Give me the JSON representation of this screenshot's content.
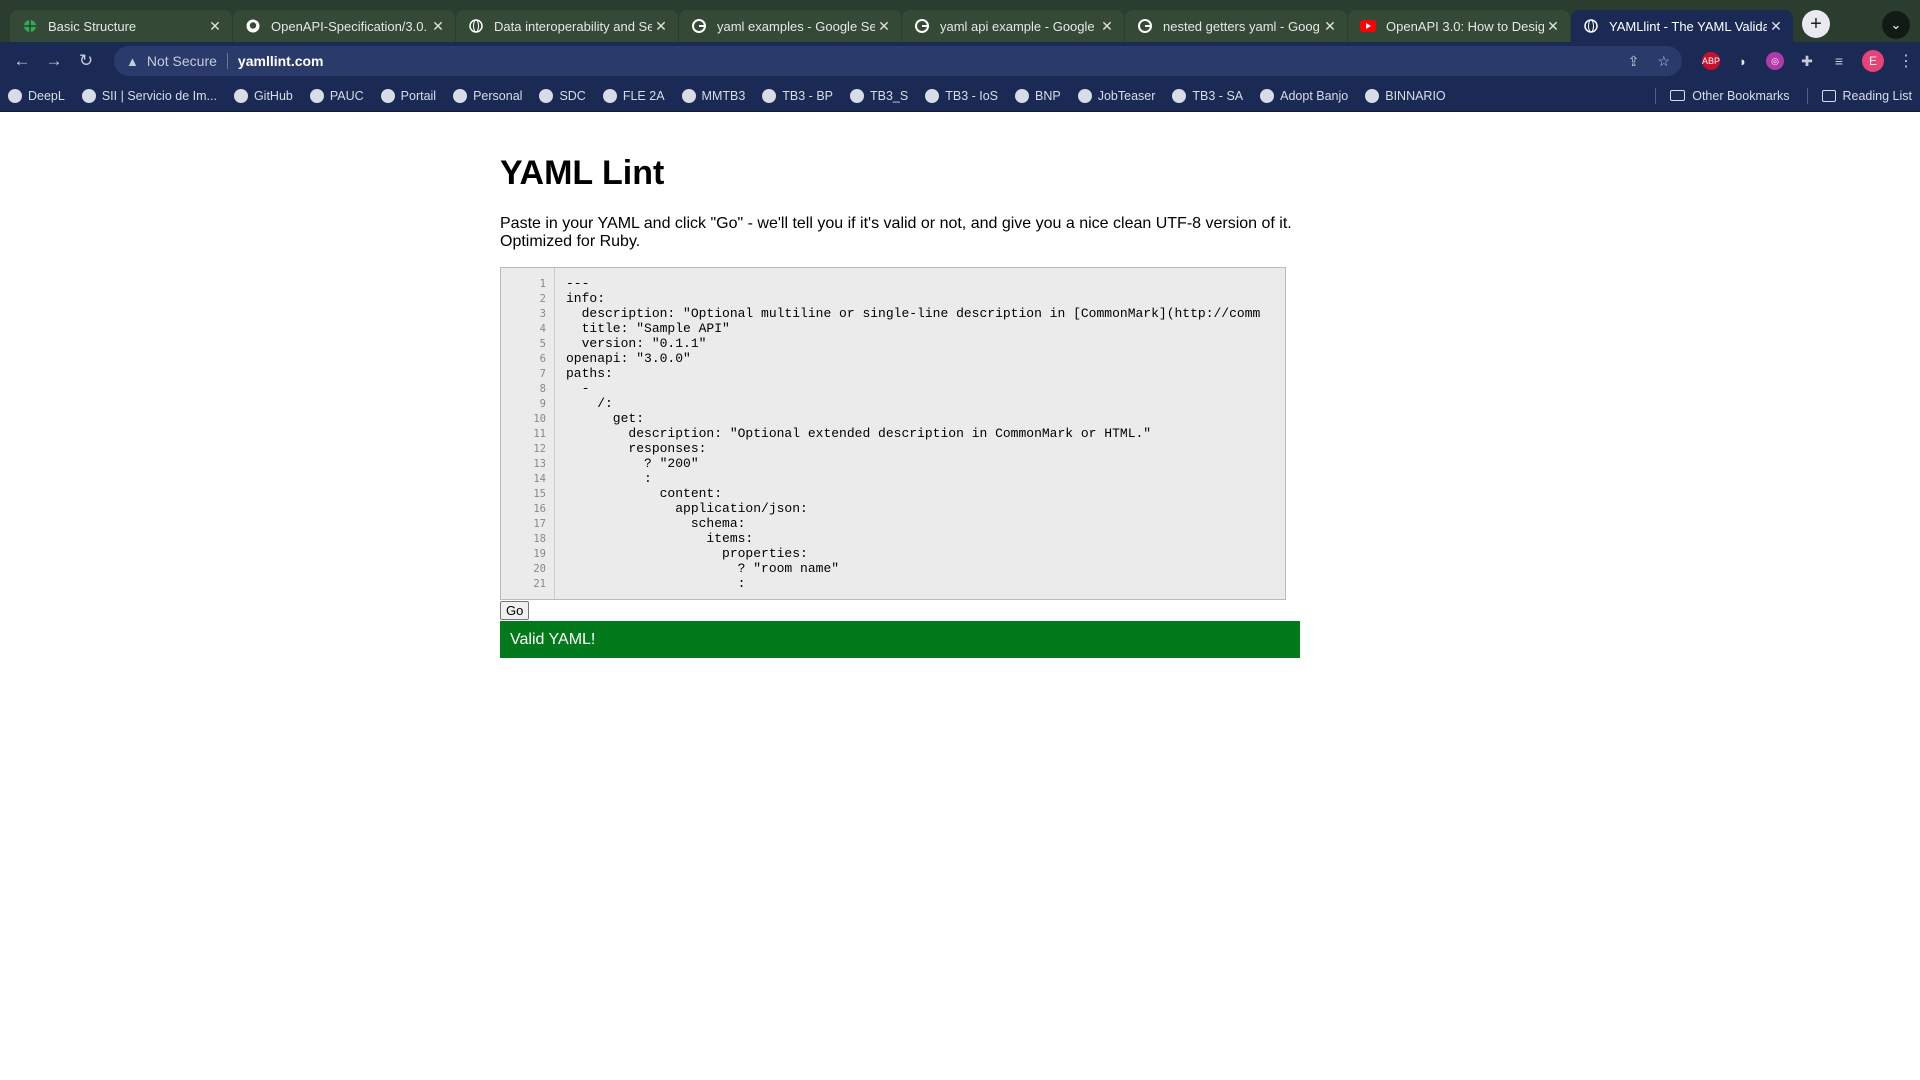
{
  "browser": {
    "tabs": [
      {
        "title": "Basic Structure",
        "favicon": "green-globe-icon",
        "active": false
      },
      {
        "title": "OpenAPI-Specification/3.0.",
        "favicon": "github-icon",
        "active": false
      },
      {
        "title": "Data interoperability and Se",
        "favicon": "globe-icon",
        "active": false
      },
      {
        "title": "yaml examples - Google Sea",
        "favicon": "google-icon",
        "active": false
      },
      {
        "title": "yaml api example - Google S",
        "favicon": "google-icon",
        "active": false
      },
      {
        "title": "nested getters yaml - Goog",
        "favicon": "google-icon",
        "active": false
      },
      {
        "title": "OpenAPI 3.0: How to Design",
        "favicon": "youtube-icon",
        "active": false
      },
      {
        "title": "YAMLlint - The YAML Valida",
        "favicon": "globe-icon",
        "active": true
      }
    ],
    "address": {
      "security_label": "Not Secure",
      "url": "yamllint.com"
    },
    "bookmarks": [
      {
        "label": "DeepL"
      },
      {
        "label": "SII | Servicio de Im..."
      },
      {
        "label": "GitHub"
      },
      {
        "label": "PAUC"
      },
      {
        "label": "Portail"
      },
      {
        "label": "Personal"
      },
      {
        "label": "SDC"
      },
      {
        "label": "FLE 2A"
      },
      {
        "label": "MMTB3"
      },
      {
        "label": "TB3 - BP"
      },
      {
        "label": "TB3_S"
      },
      {
        "label": "TB3 - IoS"
      },
      {
        "label": "BNP"
      },
      {
        "label": "JobTeaser"
      },
      {
        "label": "TB3 - SA"
      },
      {
        "label": "Adopt Banjo"
      },
      {
        "label": "BINNARIO"
      }
    ],
    "other_bookmarks": "Other Bookmarks",
    "reading_list": "Reading List",
    "profile_initial": "E"
  },
  "page": {
    "title": "YAML Lint",
    "intro": "Paste in your YAML and click \"Go\" - we'll tell you if it's valid or not, and give you a nice clean UTF-8 version of it. Optimized for Ruby.",
    "line_numbers": "1\n2\n3\n4\n5\n6\n7\n8\n9\n10\n11\n12\n13\n14\n15\n16\n17\n18\n19\n20\n21",
    "code": "---\ninfo:\n  description: \"Optional multiline or single-line description in [CommonMark](http://comm\n  title: \"Sample API\"\n  version: \"0.1.1\"\nopenapi: \"3.0.0\"\npaths:\n  -\n    /:\n      get:\n        description: \"Optional extended description in CommonMark or HTML.\"\n        responses:\n          ? \"200\"\n          :\n            content:\n              application/json:\n                schema:\n                  items:\n                    properties:\n                      ? \"room name\"\n                      :",
    "go_label": "Go",
    "result": "Valid YAML!"
  },
  "colors": {
    "valid_green": "#027a1c",
    "chrome_toolbar": "#1b2a55"
  }
}
